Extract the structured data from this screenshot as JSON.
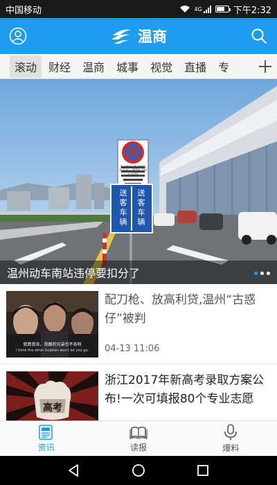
{
  "status_bar": {
    "carrier": "中国移动",
    "network": "4G",
    "time": "下午2:32",
    "battery_level": 0.6
  },
  "header": {
    "title": "温商",
    "profile_icon": "user-icon",
    "search_icon": "search-icon",
    "logo_icon": "wenshang-logo-icon",
    "color": "#1e9df0"
  },
  "tabs": {
    "items": [
      "滚动",
      "财经",
      "温商",
      "城事",
      "视觉",
      "直播",
      "专"
    ],
    "active_index": 0,
    "add_icon": "plus-icon"
  },
  "hero": {
    "caption": "温州动车南站违停要扣分了",
    "sign_text": "送客车辆",
    "notice_text": "温州南站区域 违反标志·标线 一律罚款 100元 记3分",
    "slides": 3,
    "active_slide": 0
  },
  "news": [
    {
      "title": "配刀枪、放高利贷,温州“古惑仔”被判",
      "time": "04-13 11:06",
      "thumb_subtitle_cn": "就算我肯，我跟的兄弟也不肯呀",
      "thumb_subtitle_en": "I think the other buddies won't let you go."
    },
    {
      "title": "浙江2017年新高考录取方案公布!一次可填报80个专业志愿",
      "thumb_text": "高考"
    }
  ],
  "bottom_nav": {
    "items": [
      {
        "label": "资讯",
        "icon": "news-icon"
      },
      {
        "label": "读报",
        "icon": "newspaper-icon"
      },
      {
        "label": "爆料",
        "icon": "microphone-icon"
      }
    ],
    "active_index": 0
  },
  "system_nav": {
    "back_icon": "back-icon",
    "home_icon": "home-icon",
    "recents_icon": "recents-icon"
  }
}
